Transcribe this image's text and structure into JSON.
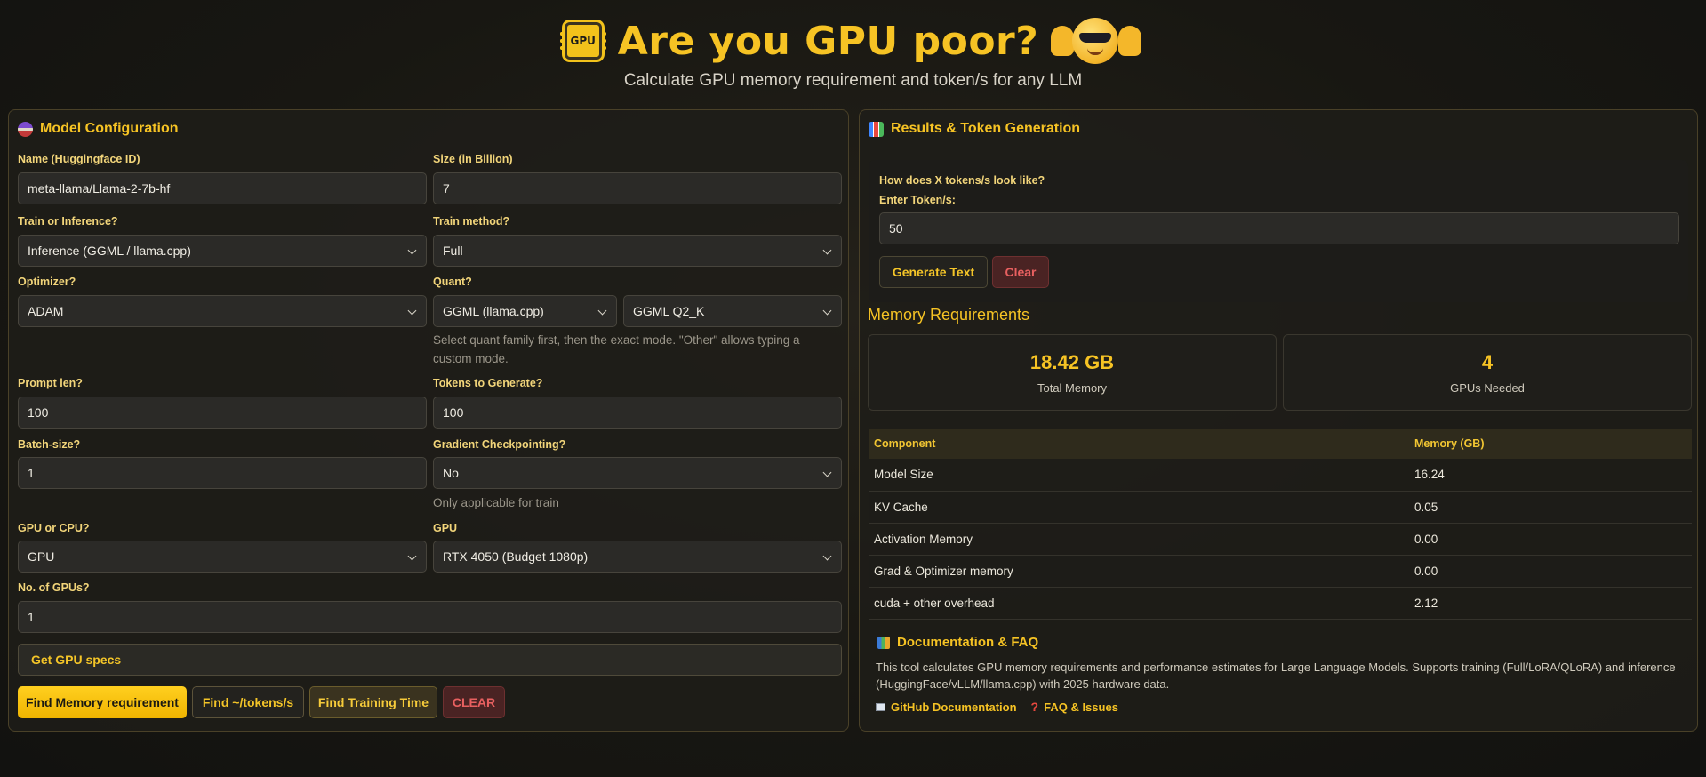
{
  "header": {
    "chip_label": "GPU",
    "title": "Are you GPU poor?",
    "subtitle": "Calculate GPU memory requirement and token/s for any LLM"
  },
  "config": {
    "title": "Model Configuration",
    "name_label": "Name (Huggingface ID)",
    "name_value": "meta-llama/Llama-2-7b-hf",
    "size_label": "Size (in Billion)",
    "size_value": "7",
    "train_inf_label": "Train or Inference?",
    "train_inf_value": "Inference (GGML / llama.cpp)",
    "train_method_label": "Train method?",
    "train_method_value": "Full",
    "optimizer_label": "Optimizer?",
    "optimizer_value": "ADAM",
    "quant_label": "Quant?",
    "quant_family_value": "GGML (llama.cpp)",
    "quant_mode_value": "GGML Q2_K",
    "quant_hint": "Select quant family first, then the exact mode. \"Other\" allows typing a custom mode.",
    "prompt_len_label": "Prompt len?",
    "prompt_len_value": "100",
    "tokens_gen_label": "Tokens to Generate?",
    "tokens_gen_value": "100",
    "batch_label": "Batch-size?",
    "batch_value": "1",
    "grad_ckpt_label": "Gradient Checkpointing?",
    "grad_ckpt_value": "No",
    "grad_ckpt_hint": "Only applicable for train",
    "gpu_cpu_label": "GPU or CPU?",
    "gpu_cpu_value": "GPU",
    "gpu_label": "GPU",
    "gpu_value": "RTX 4050 (Budget 1080p)",
    "num_gpus_label": "No. of GPUs?",
    "num_gpus_value": "1",
    "get_specs_label": "Get GPU specs",
    "find_memory_label": "Find Memory requirement",
    "find_tokens_label": "Find ~/tokens/s",
    "find_training_label": "Find Training Time",
    "clear_label": "CLEAR"
  },
  "results": {
    "title": "Results & Token Generation",
    "token_question": "How does X tokens/s look like?",
    "token_input_label": "Enter Token/s:",
    "token_input_value": "50",
    "generate_label": "Generate Text",
    "clear_label": "Clear",
    "memory_heading": "Memory Requirements",
    "total_memory_value": "18.42 GB",
    "total_memory_label": "Total Memory",
    "gpus_needed_value": "4",
    "gpus_needed_label": "GPUs Needed",
    "table_headers": [
      "Component",
      "Memory (GB)"
    ],
    "table_rows": [
      [
        "Model Size",
        "16.24"
      ],
      [
        "KV Cache",
        "0.05"
      ],
      [
        "Activation Memory",
        "0.00"
      ],
      [
        "Grad & Optimizer memory",
        "0.00"
      ],
      [
        "cuda + other overhead",
        "2.12"
      ]
    ],
    "doc_title": "Documentation & FAQ",
    "doc_text": "This tool calculates GPU memory requirements and performance estimates for Large Language Models. Supports training (Full/LoRA/QLoRA) and inference (HuggingFace/vLLM/llama.cpp) with 2025 hardware data.",
    "doc_link_github": "GitHub Documentation",
    "doc_link_faq": "FAQ & Issues"
  },
  "colors": {
    "accent": "#f6c324",
    "background": "#181712",
    "danger": "#e86060"
  }
}
